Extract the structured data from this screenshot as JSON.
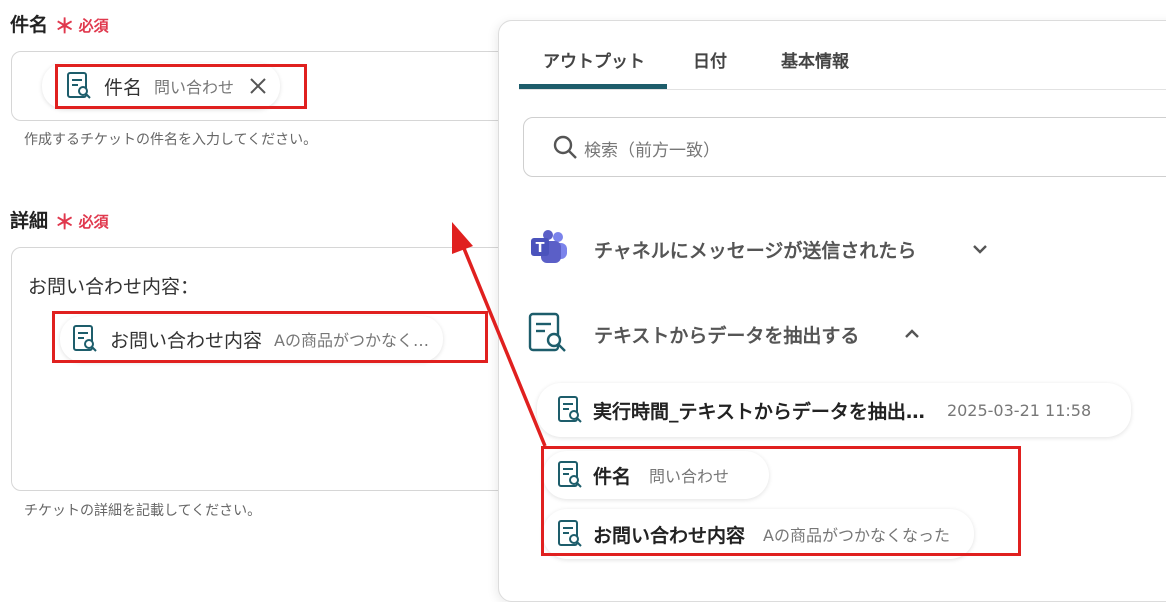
{
  "form": {
    "subject": {
      "label": "件名",
      "required": "必須",
      "chip_name": "件名",
      "chip_value": "問い合わせ",
      "help": "作成するチケットの件名を入力してください。"
    },
    "detail": {
      "label": "詳細",
      "required": "必須",
      "text_prefix": "お問い合わせ内容：",
      "chip_name": "お問い合わせ内容",
      "chip_value": "Aの商品がつかなく…",
      "help": "チケットの詳細を記載してください。"
    }
  },
  "panel": {
    "tabs": [
      "アウトプット",
      "日付",
      "基本情報"
    ],
    "search_placeholder": "検索（前方一致）",
    "sections": [
      {
        "title": "チャネルにメッセージが送信されたら"
      },
      {
        "title": "テキストからデータを抽出する"
      }
    ],
    "outputs": [
      {
        "name": "実行時間_テキストからデータを抽出…",
        "value": "2025-03-21 11:58"
      },
      {
        "name": "件名",
        "value": "問い合わせ"
      },
      {
        "name": "お問い合わせ内容",
        "value": "Aの商品がつかなくなった"
      }
    ]
  },
  "colors": {
    "accent": "#1d5d6b",
    "required": "#e0384d",
    "highlight": "#e0201f",
    "teams": "#5b5fc7"
  }
}
